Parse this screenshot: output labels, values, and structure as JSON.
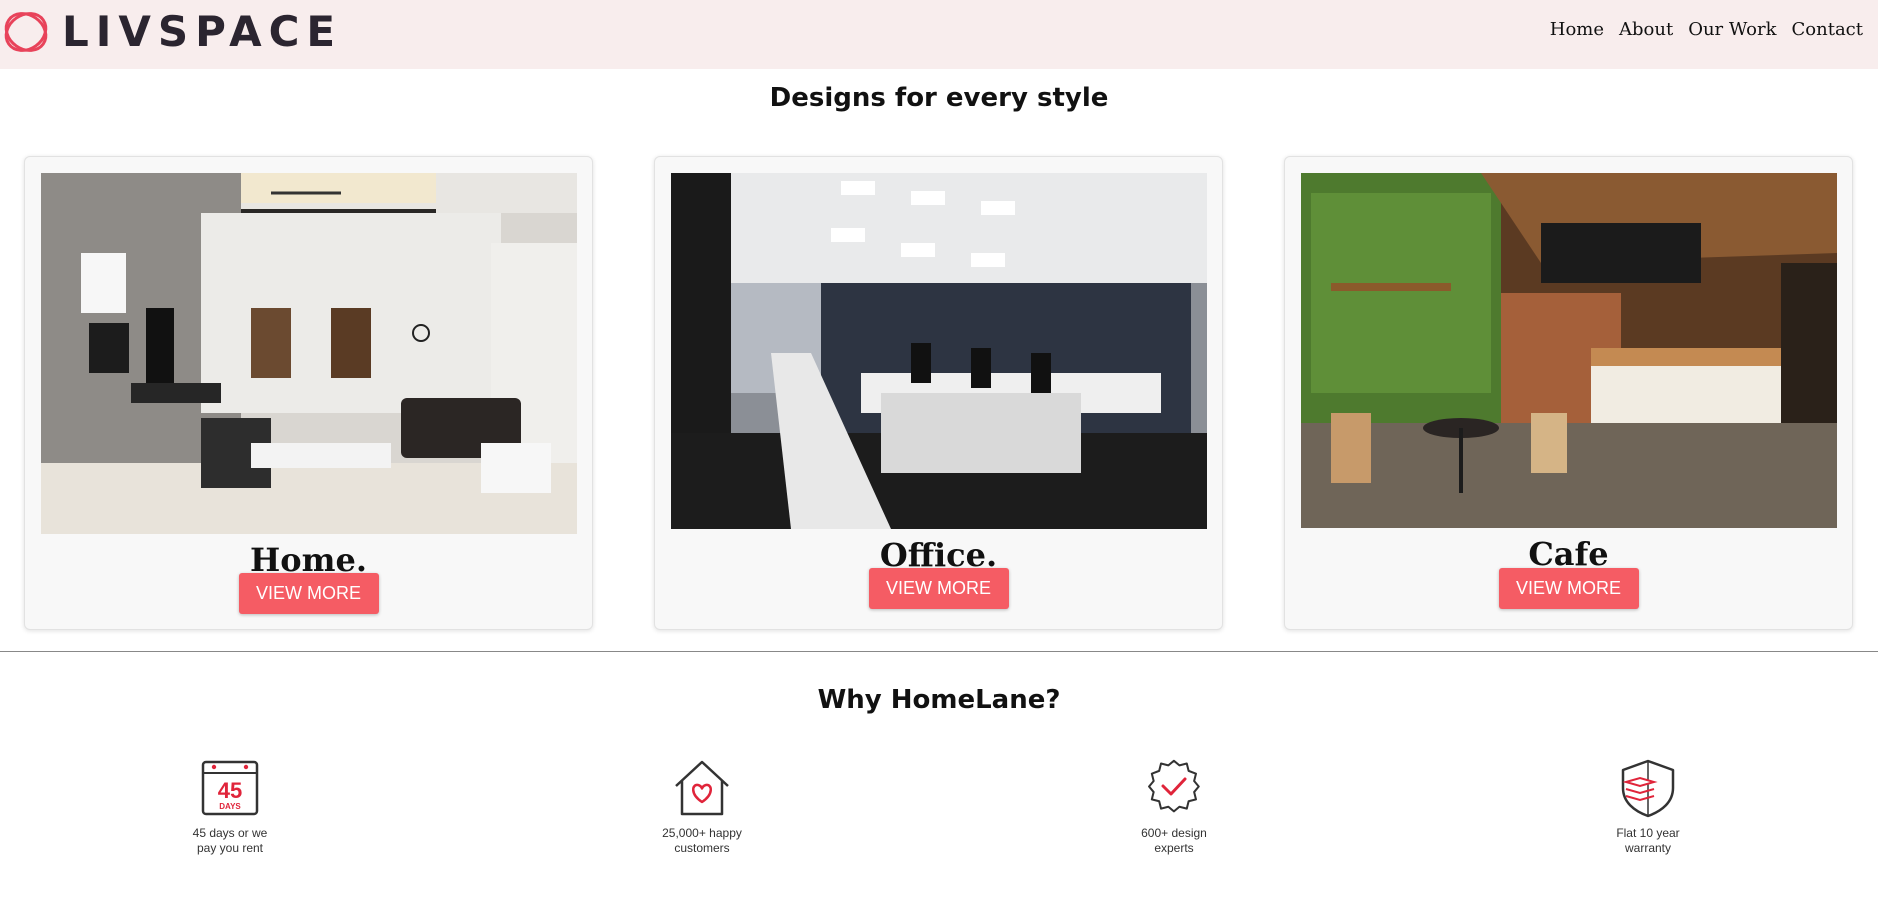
{
  "header": {
    "brand": "LIVSPACE",
    "nav": [
      "Home",
      "About",
      "Our Work",
      "Contact"
    ]
  },
  "designs": {
    "title": "Designs for every style",
    "cards": [
      {
        "title": "Home.",
        "button": "VIEW MORE"
      },
      {
        "title": "Office.",
        "button": "VIEW MORE"
      },
      {
        "title": "Cafe",
        "button": "VIEW MORE"
      }
    ]
  },
  "why": {
    "title": "Why HomeLane?",
    "features": [
      {
        "icon": "calendar-45-icon",
        "icon_number": "45",
        "icon_label": "DAYS",
        "text": "45 days or we pay you rent"
      },
      {
        "icon": "house-heart-icon",
        "text": "25,000+ happy customers"
      },
      {
        "icon": "badge-check-icon",
        "text": "600+ design experts"
      },
      {
        "icon": "shield-layers-icon",
        "text": "Flat 10 year warranty"
      }
    ]
  },
  "colors": {
    "header_bg": "#f8eded",
    "button": "#f55c64",
    "logo_ring": "#e8435a",
    "icon_accent": "#e0243a"
  }
}
